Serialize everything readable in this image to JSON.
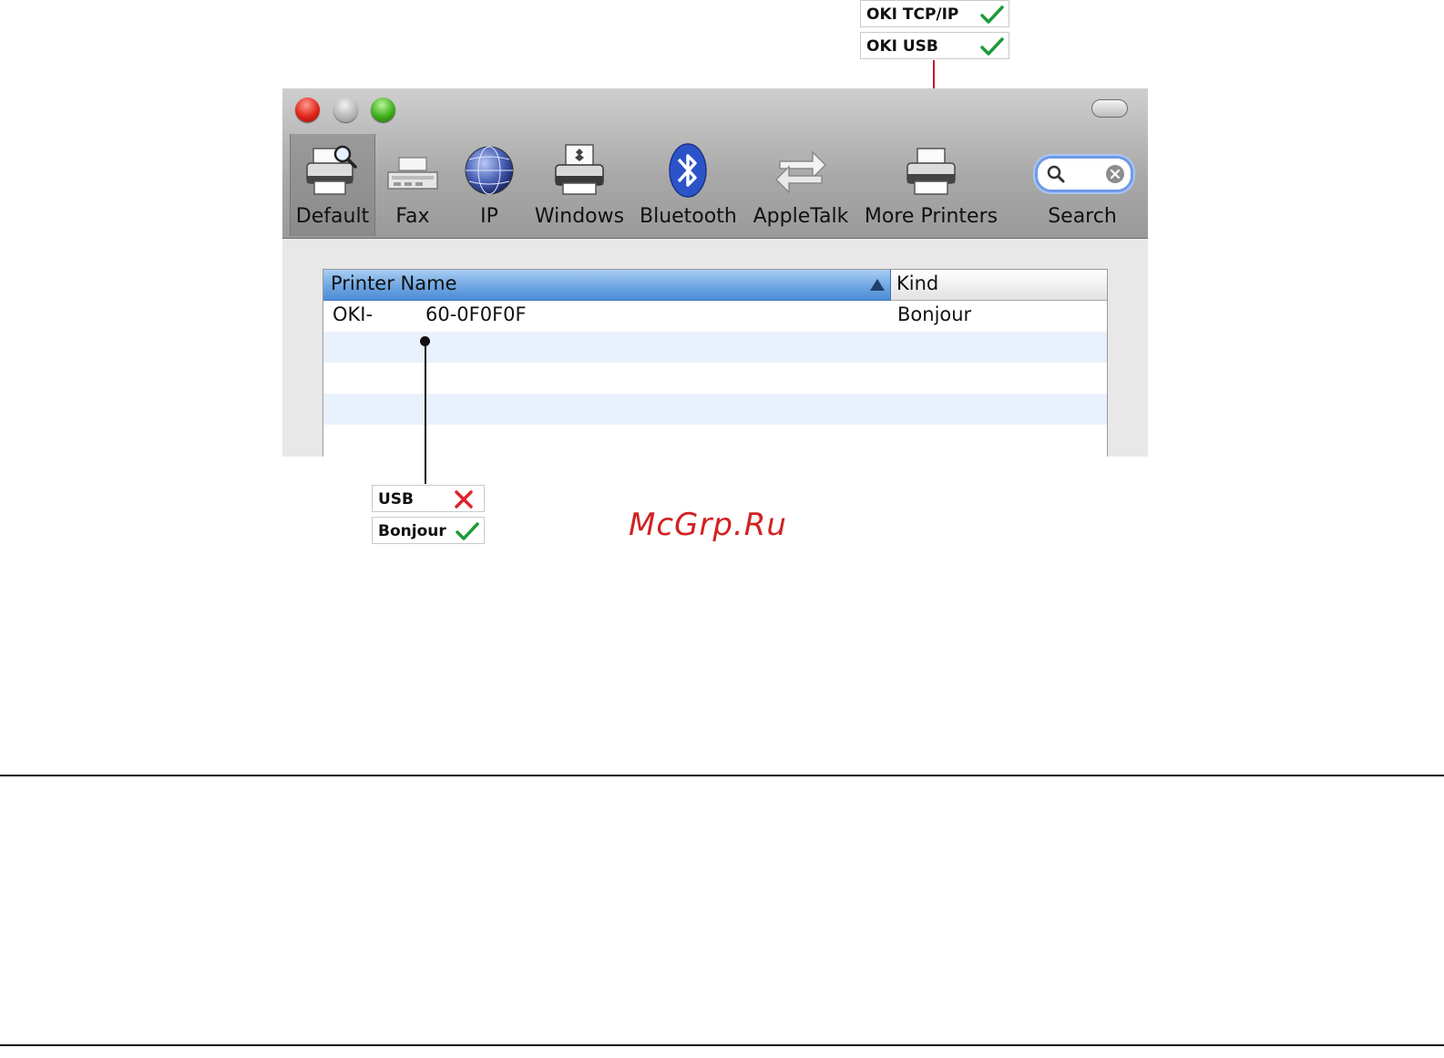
{
  "toolbar": {
    "items": [
      {
        "label": "Default",
        "icon": "default-printer-magnifier-icon",
        "selected": true
      },
      {
        "label": "Fax",
        "icon": "fax-icon"
      },
      {
        "label": "IP",
        "icon": "ip-globe-icon"
      },
      {
        "label": "Windows",
        "icon": "windows-printer-icon"
      },
      {
        "label": "Bluetooth",
        "icon": "bluetooth-icon"
      },
      {
        "label": "AppleTalk",
        "icon": "appletalk-arrows-icon"
      },
      {
        "label": "More Printers",
        "icon": "more-printers-icon"
      },
      {
        "label": "Search",
        "icon": "search-field-icon"
      }
    ]
  },
  "table": {
    "columns": [
      "Printer Name",
      "Kind"
    ],
    "sorted_column": "Printer Name",
    "rows": [
      {
        "name_prefix": "OKI-",
        "name_suffix": "60-0F0F0F",
        "kind": "Bonjour"
      }
    ]
  },
  "callouts": {
    "top": [
      {
        "label": "OKI TCP/IP",
        "mark": "check"
      },
      {
        "label": "OKI USB",
        "mark": "check"
      }
    ],
    "bottom": [
      {
        "label": "USB",
        "mark": "cross"
      },
      {
        "label": "Bonjour",
        "mark": "check"
      }
    ]
  },
  "watermark": "McGrp.Ru",
  "colors": {
    "check": "#1f9a3a",
    "cross": "#e0242c",
    "top_leader": "#c8102e",
    "bottom_leader": "#111111",
    "header_selected": "#6fa6e2",
    "row_alt": "#e9f1fc"
  }
}
